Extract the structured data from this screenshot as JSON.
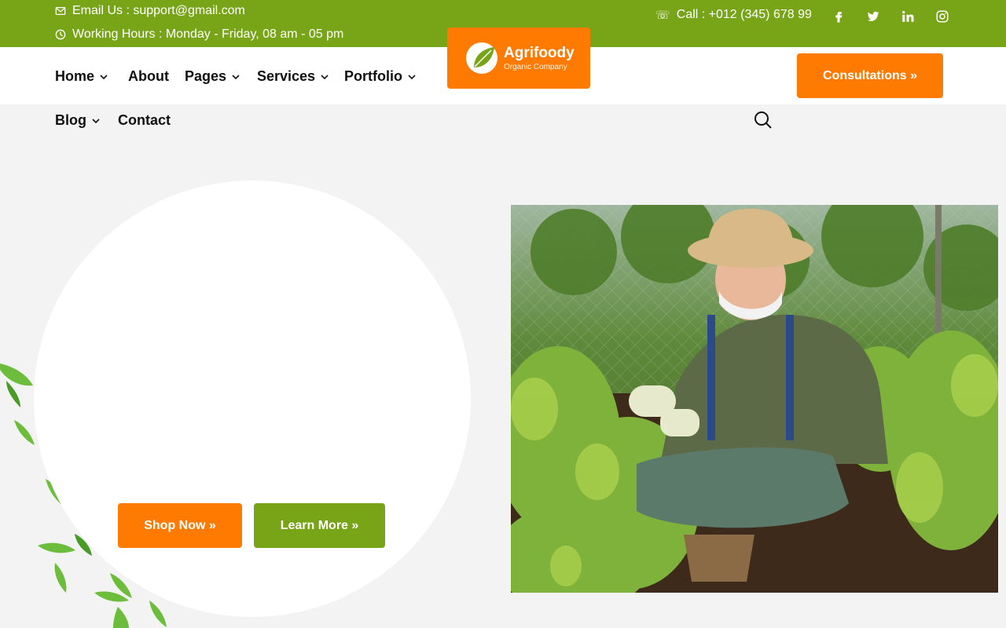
{
  "topbar": {
    "email": "Email Us : support@gmail.com",
    "hours": "Working Hours : Monday - Friday, 08 am - 05 pm",
    "call": "Call : +012 (345) 678 99",
    "socials": [
      "facebook-icon",
      "twitter-icon",
      "linkedin-icon",
      "instagram-icon"
    ],
    "background_color": "#78a417"
  },
  "logo": {
    "name": "Agrifoody",
    "tagline": "Organic Company",
    "background_color": "#ff7a00"
  },
  "nav": {
    "items": [
      {
        "label": "Home",
        "dropdown": true
      },
      {
        "label": "About",
        "dropdown": false
      },
      {
        "label": "Pages",
        "dropdown": true
      },
      {
        "label": "Services",
        "dropdown": true
      },
      {
        "label": "Portfolio",
        "dropdown": true
      },
      {
        "label": "Blog",
        "dropdown": true
      },
      {
        "label": "Contact",
        "dropdown": false
      }
    ],
    "search_icon": "search-icon",
    "cta_label": "Consultations »"
  },
  "hero": {
    "shop_label": "Shop Now »",
    "learn_label": "Learn More »",
    "accent_orange": "#ff7a00",
    "accent_green": "#78a417"
  }
}
